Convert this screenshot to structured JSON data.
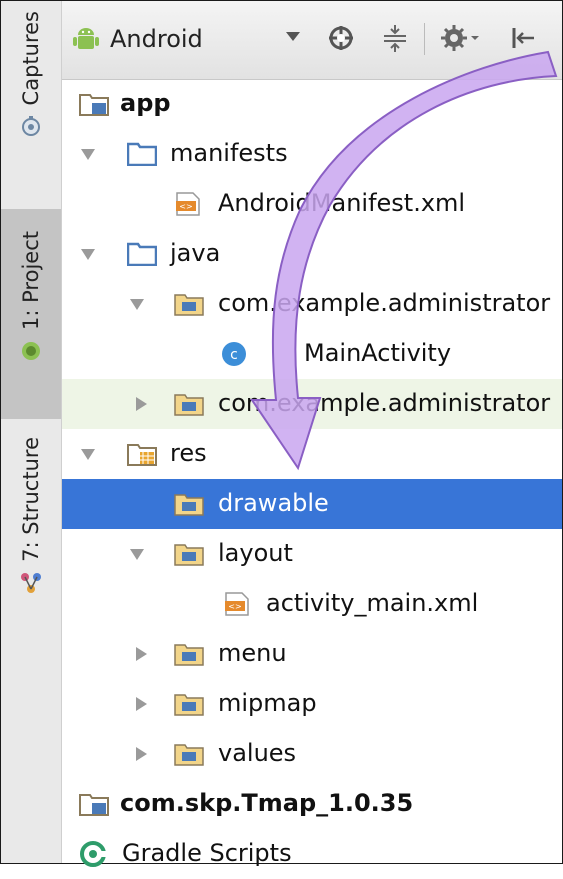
{
  "side_tabs": [
    {
      "label": "Captures",
      "icon": "captures-icon"
    },
    {
      "label": "1: Project",
      "icon": "android-icon"
    },
    {
      "label": "7: Structure",
      "icon": "structure-icon"
    }
  ],
  "toolbar": {
    "view_selector": "Android",
    "buttons": [
      "sync-target-icon",
      "collapse-all-icon",
      "settings-icon",
      "hide-panel-icon"
    ]
  },
  "tree": [
    {
      "label": "app",
      "bold": true,
      "icon": "module-folder-icon"
    },
    {
      "label": "manifests",
      "icon": "folder-icon",
      "expanded": true
    },
    {
      "label": "AndroidManifest.xml",
      "icon": "xml-file-icon"
    },
    {
      "label": "java",
      "icon": "folder-icon",
      "expanded": true
    },
    {
      "label": "com.example.administrator",
      "icon": "package-icon",
      "expanded": true
    },
    {
      "label": "MainActivity",
      "icon": "class-icon"
    },
    {
      "label": "com.example.administrator",
      "icon": "package-icon",
      "expanded": false
    },
    {
      "label": "res",
      "icon": "res-folder-icon",
      "expanded": true
    },
    {
      "label": "drawable",
      "icon": "package-icon",
      "selected": true
    },
    {
      "label": "layout",
      "icon": "package-icon",
      "expanded": true
    },
    {
      "label": "activity_main.xml",
      "icon": "xml-file-icon"
    },
    {
      "label": "menu",
      "icon": "package-icon",
      "expanded": false
    },
    {
      "label": "mipmap",
      "icon": "package-icon",
      "expanded": false
    },
    {
      "label": "values",
      "icon": "package-icon",
      "expanded": false
    },
    {
      "label": "com.skp.Tmap_1.0.35",
      "bold": true,
      "icon": "module-folder-icon"
    },
    {
      "label": "Gradle Scripts",
      "icon": "gradle-icon"
    }
  ],
  "colors": {
    "selection": "#3875d7",
    "folder": "#4a7ab8",
    "package_fill": "#f2d58a",
    "annotation_arrow": "#c9a6f0"
  }
}
